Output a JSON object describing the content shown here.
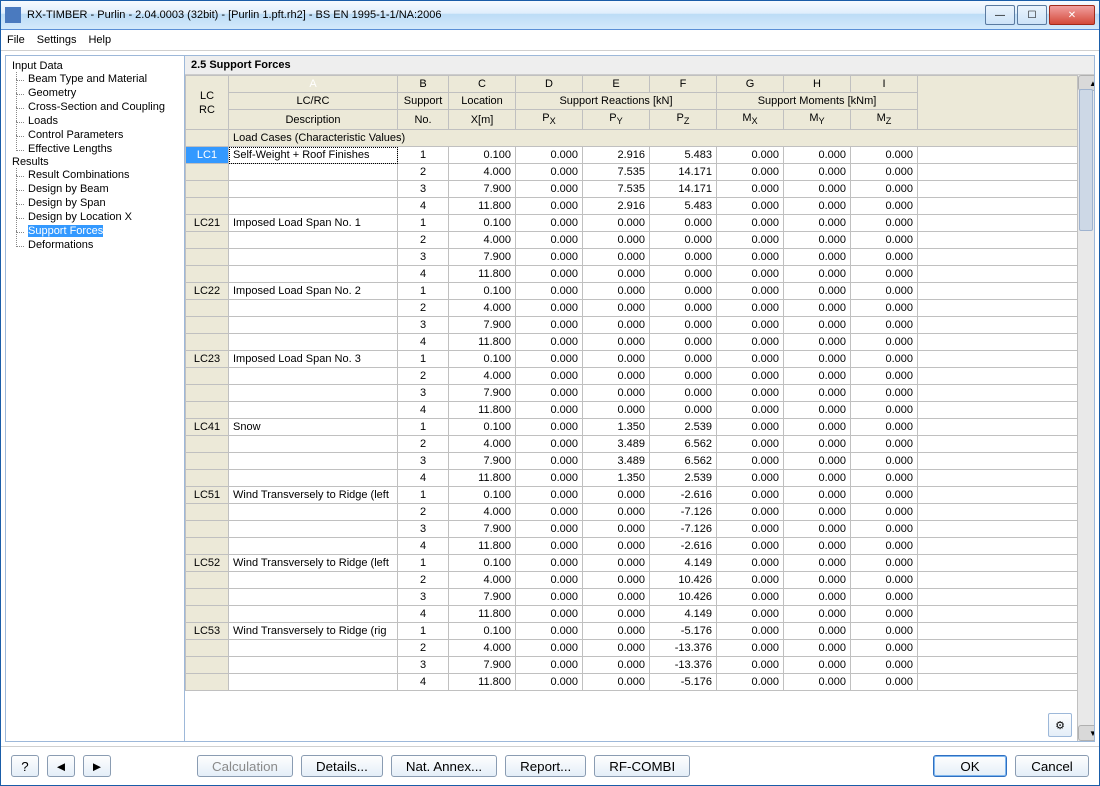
{
  "window": {
    "title": "RX-TIMBER - Purlin - 2.04.0003 (32bit) - [Purlin 1.pft.rh2] - BS EN 1995-1-1/NA:2006"
  },
  "menu": {
    "file": "File",
    "settings": "Settings",
    "help": "Help"
  },
  "sidebar": {
    "input_data": "Input Data",
    "input_children": [
      "Beam Type and Material",
      "Geometry",
      "Cross-Section and Coupling",
      "Loads",
      "Control Parameters",
      "Effective Lengths"
    ],
    "results": "Results",
    "results_children": [
      "Result Combinations",
      "Design by Beam",
      "Design by Span",
      "Design by Location X",
      "Support Forces",
      "Deformations"
    ],
    "selected_index": 4
  },
  "content": {
    "title": "2.5 Support Forces",
    "col_letters": [
      "A",
      "B",
      "C",
      "D",
      "E",
      "F",
      "G",
      "H",
      "I"
    ],
    "lcrc": "LC\nRC",
    "header_row1": [
      "LC/RC",
      "Support",
      "Location",
      "Support Reactions [kN]",
      "Support Moments [kNm]"
    ],
    "header_row2": [
      "Description",
      "No.",
      "X[m]",
      "P",
      "P",
      "P",
      "M",
      "M",
      "M"
    ],
    "sub_xyz": [
      "X",
      "Y",
      "Z",
      "X",
      "Y",
      "Z"
    ],
    "section_title": "Load Cases (Characteristic Values)",
    "groups": [
      {
        "id": "LC1",
        "desc": "Self-Weight + Roof Finishes",
        "rows": [
          [
            1,
            0.1,
            0.0,
            2.916,
            5.483,
            0.0,
            0.0,
            0.0
          ],
          [
            2,
            4.0,
            0.0,
            7.535,
            14.171,
            0.0,
            0.0,
            0.0
          ],
          [
            3,
            7.9,
            0.0,
            7.535,
            14.171,
            0.0,
            0.0,
            0.0
          ],
          [
            4,
            11.8,
            0.0,
            2.916,
            5.483,
            0.0,
            0.0,
            0.0
          ]
        ]
      },
      {
        "id": "LC21",
        "desc": "Imposed Load Span No. 1",
        "rows": [
          [
            1,
            0.1,
            0.0,
            0.0,
            0.0,
            0.0,
            0.0,
            0.0
          ],
          [
            2,
            4.0,
            0.0,
            0.0,
            0.0,
            0.0,
            0.0,
            0.0
          ],
          [
            3,
            7.9,
            0.0,
            0.0,
            0.0,
            0.0,
            0.0,
            0.0
          ],
          [
            4,
            11.8,
            0.0,
            0.0,
            0.0,
            0.0,
            0.0,
            0.0
          ]
        ]
      },
      {
        "id": "LC22",
        "desc": "Imposed Load Span No. 2",
        "rows": [
          [
            1,
            0.1,
            0.0,
            0.0,
            0.0,
            0.0,
            0.0,
            0.0
          ],
          [
            2,
            4.0,
            0.0,
            0.0,
            0.0,
            0.0,
            0.0,
            0.0
          ],
          [
            3,
            7.9,
            0.0,
            0.0,
            0.0,
            0.0,
            0.0,
            0.0
          ],
          [
            4,
            11.8,
            0.0,
            0.0,
            0.0,
            0.0,
            0.0,
            0.0
          ]
        ]
      },
      {
        "id": "LC23",
        "desc": "Imposed Load Span No. 3",
        "rows": [
          [
            1,
            0.1,
            0.0,
            0.0,
            0.0,
            0.0,
            0.0,
            0.0
          ],
          [
            2,
            4.0,
            0.0,
            0.0,
            0.0,
            0.0,
            0.0,
            0.0
          ],
          [
            3,
            7.9,
            0.0,
            0.0,
            0.0,
            0.0,
            0.0,
            0.0
          ],
          [
            4,
            11.8,
            0.0,
            0.0,
            0.0,
            0.0,
            0.0,
            0.0
          ]
        ]
      },
      {
        "id": "LC41",
        "desc": "Snow",
        "rows": [
          [
            1,
            0.1,
            0.0,
            1.35,
            2.539,
            0.0,
            0.0,
            0.0
          ],
          [
            2,
            4.0,
            0.0,
            3.489,
            6.562,
            0.0,
            0.0,
            0.0
          ],
          [
            3,
            7.9,
            0.0,
            3.489,
            6.562,
            0.0,
            0.0,
            0.0
          ],
          [
            4,
            11.8,
            0.0,
            1.35,
            2.539,
            0.0,
            0.0,
            0.0
          ]
        ]
      },
      {
        "id": "LC51",
        "desc": "Wind Transversely to Ridge (left",
        "rows": [
          [
            1,
            0.1,
            0.0,
            0.0,
            -2.616,
            0.0,
            0.0,
            0.0
          ],
          [
            2,
            4.0,
            0.0,
            0.0,
            -7.126,
            0.0,
            0.0,
            0.0
          ],
          [
            3,
            7.9,
            0.0,
            0.0,
            -7.126,
            0.0,
            0.0,
            0.0
          ],
          [
            4,
            11.8,
            0.0,
            0.0,
            -2.616,
            0.0,
            0.0,
            0.0
          ]
        ]
      },
      {
        "id": "LC52",
        "desc": "Wind Transversely to Ridge (left",
        "rows": [
          [
            1,
            0.1,
            0.0,
            0.0,
            4.149,
            0.0,
            0.0,
            0.0
          ],
          [
            2,
            4.0,
            0.0,
            0.0,
            10.426,
            0.0,
            0.0,
            0.0
          ],
          [
            3,
            7.9,
            0.0,
            0.0,
            10.426,
            0.0,
            0.0,
            0.0
          ],
          [
            4,
            11.8,
            0.0,
            0.0,
            4.149,
            0.0,
            0.0,
            0.0
          ]
        ]
      },
      {
        "id": "LC53",
        "desc": "Wind Transversely to Ridge (rig",
        "rows": [
          [
            1,
            0.1,
            0.0,
            0.0,
            -5.176,
            0.0,
            0.0,
            0.0
          ],
          [
            2,
            4.0,
            0.0,
            0.0,
            -13.376,
            0.0,
            0.0,
            0.0
          ],
          [
            3,
            7.9,
            0.0,
            0.0,
            -13.376,
            0.0,
            0.0,
            0.0
          ],
          [
            4,
            11.8,
            0.0,
            0.0,
            -5.176,
            0.0,
            0.0,
            0.0
          ]
        ]
      }
    ]
  },
  "footer": {
    "calculation": "Calculation",
    "details": "Details...",
    "nat_annex": "Nat. Annex...",
    "report": "Report...",
    "rfcombi": "RF-COMBI",
    "ok": "OK",
    "cancel": "Cancel"
  }
}
